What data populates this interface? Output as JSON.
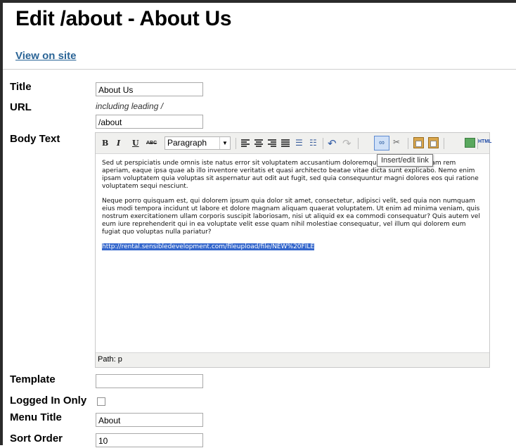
{
  "page": {
    "title": "Edit /about - About Us",
    "view_link": "View on site"
  },
  "form": {
    "title": {
      "label": "Title",
      "value": "About Us"
    },
    "url": {
      "label": "URL",
      "hint": "including leading /",
      "value": "/about"
    },
    "body": {
      "label": "Body Text"
    },
    "template": {
      "label": "Template",
      "value": ""
    },
    "logged_in_only": {
      "label": "Logged In Only",
      "checked": false
    },
    "menu_title": {
      "label": "Menu Title",
      "value": "About"
    },
    "sort_order": {
      "label": "Sort Order",
      "value": "10"
    }
  },
  "editor": {
    "toolbar": {
      "bold": "B",
      "italic": "I",
      "underline": "U",
      "strikethrough": "ABC",
      "format_select": "Paragraph",
      "html": "HTML"
    },
    "tooltip": "Insert/edit link",
    "paragraphs": [
      "Sed ut perspiciatis unde omnis iste natus error sit voluptatem accusantium doloremque laudantium, totam rem aperiam, eaque ipsa quae ab illo inventore veritatis et quasi architecto beatae vitae dicta sunt explicabo. Nemo enim ipsam voluptatem quia voluptas sit aspernatur aut odit aut fugit, sed quia consequuntur magni dolores eos qui ratione voluptatem sequi nesciunt.",
      "Neque porro quisquam est, qui dolorem ipsum quia dolor sit amet, consectetur, adipisci velit, sed quia non numquam eius modi tempora incidunt ut labore et dolore magnam aliquam quaerat voluptatem. Ut enim ad minima veniam, quis nostrum exercitationem ullam corporis suscipit laboriosam, nisi ut aliquid ex ea commodi consequatur? Quis autem vel eum iure reprehenderit qui in ea voluptate velit esse quam nihil molestiae consequatur, vel illum qui dolorem eum fugiat quo voluptas nulla pariatur?"
    ],
    "selected_link": "http://rental.sensibledevelopment.com/fileupload/file/NEW%20FILE",
    "path": "Path: p"
  }
}
